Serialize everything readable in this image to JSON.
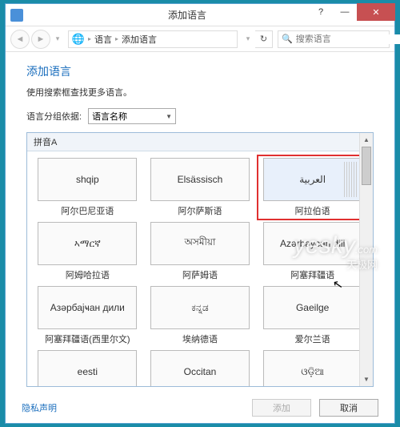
{
  "window": {
    "title": "添加语言",
    "controls": {
      "help": "?",
      "minimize": "—",
      "close": "✕"
    }
  },
  "nav": {
    "breadcrumb": {
      "item1": "语言",
      "item2": "添加语言"
    },
    "search_placeholder": "搜索语言"
  },
  "page": {
    "title": "添加语言",
    "subtitle": "使用搜索框查找更多语言。",
    "group_label": "语言分组依据:",
    "group_value": "语言名称"
  },
  "list": {
    "section_header": "拼音A",
    "items": [
      {
        "native": "shqip",
        "label": "阿尔巴尼亚语",
        "selected": false
      },
      {
        "native": "Elsässisch",
        "label": "阿尔萨斯语",
        "selected": false
      },
      {
        "native": "العربية",
        "label": "阿拉伯语",
        "selected": true,
        "rtl": true
      },
      {
        "native": "ኣማርኛ",
        "label": "阿姆哈拉语",
        "selected": false
      },
      {
        "native": "অসমীয়া",
        "label": "阿萨姆语",
        "selected": false
      },
      {
        "native": "Azərbaycan dili",
        "label": "阿塞拜疆语",
        "selected": false
      },
      {
        "native": "Азәрбајҹан дили",
        "label": "阿塞拜疆语(西里尔文)",
        "selected": false
      },
      {
        "native": "ಕನ್ನಡ",
        "label": "埃纳德语",
        "selected": false
      },
      {
        "native": "Gaeilge",
        "label": "爱尔兰语",
        "selected": false
      },
      {
        "native": "eesti",
        "label": "",
        "selected": false
      },
      {
        "native": "Occitan",
        "label": "",
        "selected": false
      },
      {
        "native": "ଓଡ଼ିଆ",
        "label": "",
        "selected": false
      }
    ]
  },
  "footer": {
    "privacy": "隐私声明",
    "add": "添加",
    "cancel": "取消"
  },
  "watermark": {
    "brand": "yesky",
    "sub": "天极网",
    "dotcom": ".com"
  }
}
